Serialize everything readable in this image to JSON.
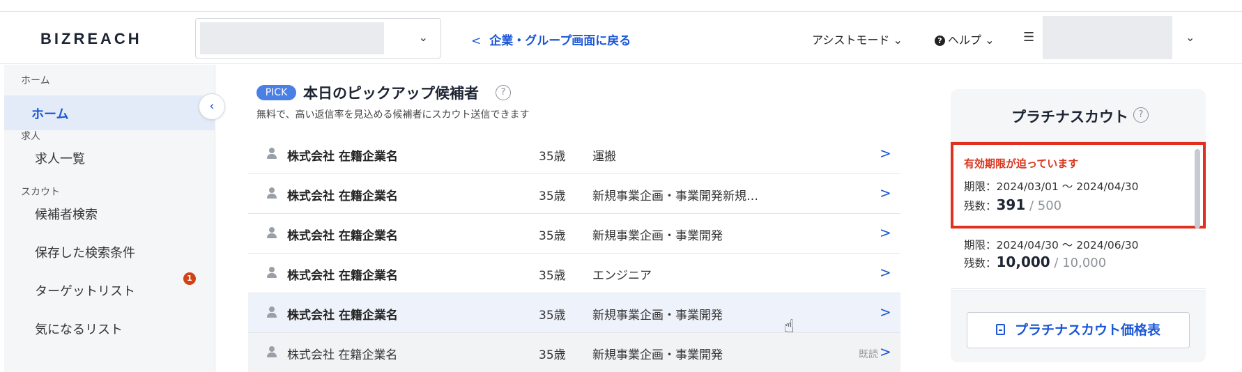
{
  "header": {
    "logo": "BIZREACH",
    "company_select_chevron": "⌄",
    "back_link_chevron": "<",
    "back_link": "企業・グループ画面に戻る",
    "assist_mode": "アシストモード ⌄",
    "help_icon_glyph": "?",
    "help": "ヘルプ ⌄",
    "tasks_icon": "☰",
    "user_chevron": "⌄"
  },
  "sidebar": {
    "sections": [
      {
        "label": "ホーム"
      },
      {
        "label": "求人"
      },
      {
        "label": "スカウト"
      }
    ],
    "items": [
      {
        "label": "ホーム",
        "active": true
      },
      {
        "label": "求人一覧"
      },
      {
        "label": "候補者検索"
      },
      {
        "label": "保存した検索条件",
        "badge": "1"
      },
      {
        "label": "ターゲットリスト"
      },
      {
        "label": "気になるリスト"
      }
    ],
    "collapse_glyph": "‹"
  },
  "pickup": {
    "badge": "PICK",
    "title": "本日のピックアップ候補者",
    "help_glyph": "?",
    "subtitle": "無料で、高い返信率を見込める候補者にスカウト送信できます",
    "row_chevron": ">",
    "rows": [
      {
        "company": "株式会社 在籍企業名",
        "age": "35歳",
        "job": "運搬"
      },
      {
        "company": "株式会社 在籍企業名",
        "age": "35歳",
        "job": "新規事業企画・事業開発新規…"
      },
      {
        "company": "株式会社 在籍企業名",
        "age": "35歳",
        "job": "新規事業企画・事業開発"
      },
      {
        "company": "株式会社 在籍企業名",
        "age": "35歳",
        "job": "エンジニア"
      },
      {
        "company": "株式会社 在籍企業名",
        "age": "35歳",
        "job": "新規事業企画・事業開発"
      },
      {
        "company": "株式会社 在籍企業名",
        "age": "35歳",
        "job": "新規事業企画・事業開発",
        "read_label": "既読"
      }
    ]
  },
  "platinum": {
    "title": "プラチナスカウト",
    "help_glyph": "?",
    "cards": [
      {
        "warning": "有効期限が迫っています",
        "period": "期限：2024/03/01 ～ 2024/04/30",
        "remain_label": "残数：",
        "remain": "391",
        "total": " / 500"
      },
      {
        "period": "期限：2024/04/30 ～ 2024/06/30",
        "remain_label": "残数：",
        "remain": "10,000",
        "total": " / 10,000"
      }
    ],
    "price_button": "プラチナスカウト価格表"
  },
  "colors": {
    "accent": "#1a56d6",
    "warning": "#e0301e",
    "badge": "#d14217",
    "pick": "#4a7fe6"
  }
}
